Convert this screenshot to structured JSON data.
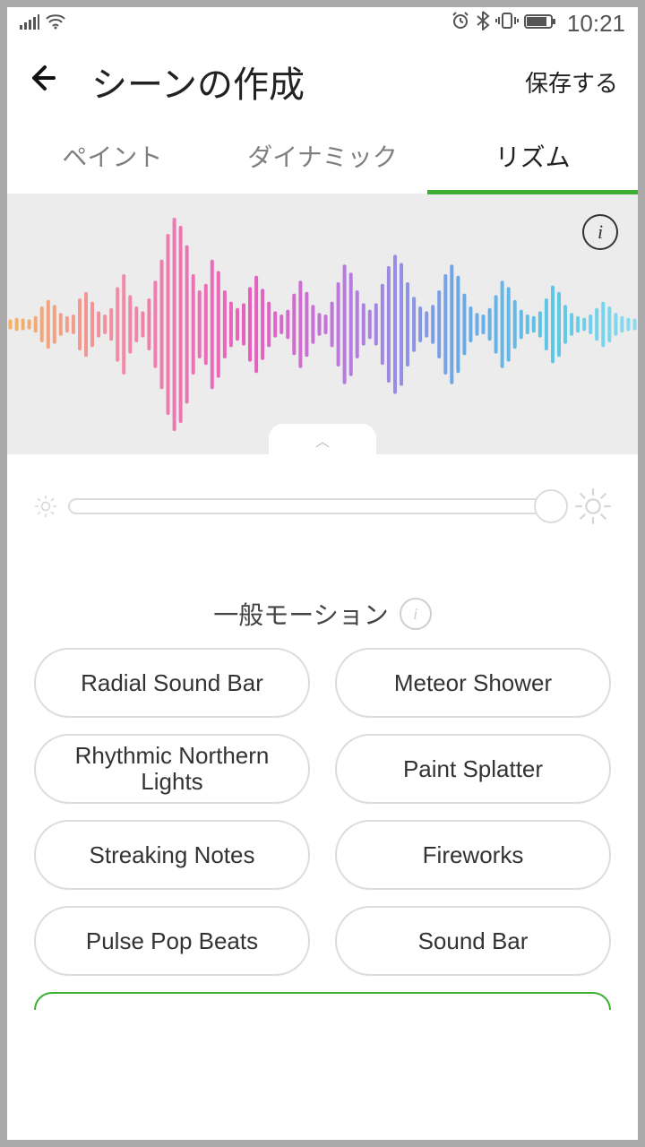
{
  "status": {
    "time": "10:21"
  },
  "header": {
    "title": "シーンの作成",
    "save": "保存する"
  },
  "tabs": {
    "paint": "ペイント",
    "dynamic": "ダイナミック",
    "rhythm": "リズム"
  },
  "section": {
    "title": "一般モーション"
  },
  "motions": {
    "items": [
      "Radial Sound Bar",
      "Meteor Shower",
      "Rhythmic Northern Lights",
      "Paint Splatter",
      "Streaking Notes",
      "Fireworks",
      "Pulse Pop Beats",
      "Sound Bar"
    ]
  },
  "slider": {
    "value": 100
  }
}
